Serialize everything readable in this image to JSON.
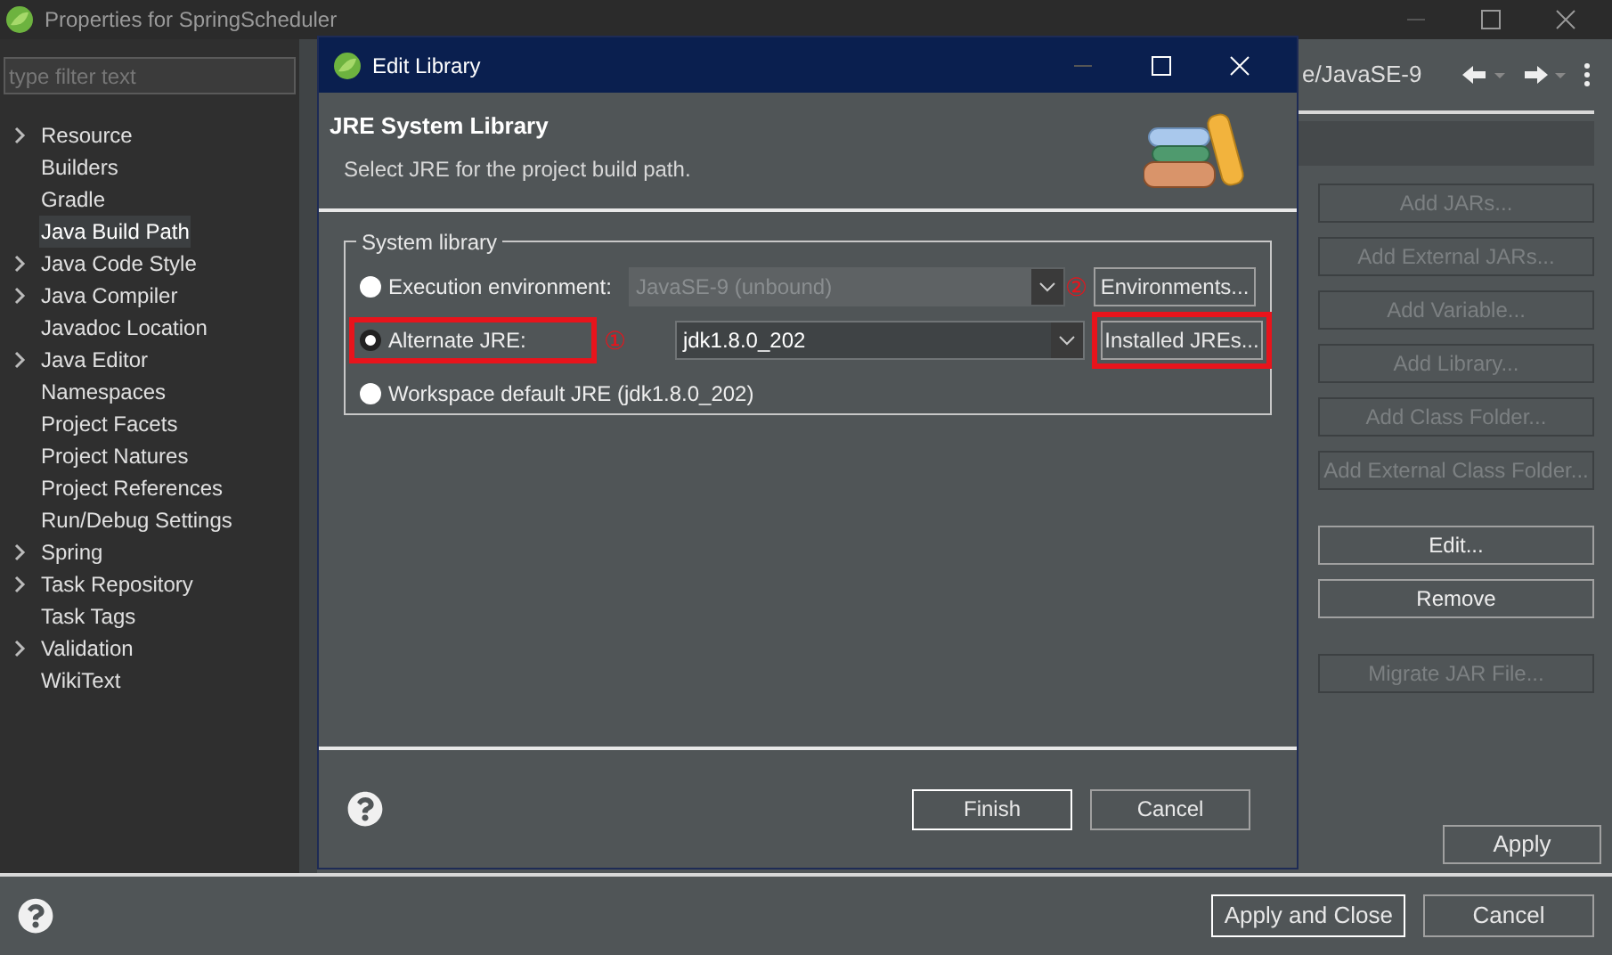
{
  "window": {
    "title": "Properties for SpringScheduler"
  },
  "filter": {
    "placeholder": "type filter text"
  },
  "sidebar": {
    "items": [
      {
        "label": "Resource",
        "has_children": true,
        "selected": false
      },
      {
        "label": "Builders",
        "has_children": false,
        "selected": false
      },
      {
        "label": "Gradle",
        "has_children": false,
        "selected": false
      },
      {
        "label": "Java Build Path",
        "has_children": false,
        "selected": true
      },
      {
        "label": "Java Code Style",
        "has_children": true,
        "selected": false
      },
      {
        "label": "Java Compiler",
        "has_children": true,
        "selected": false
      },
      {
        "label": "Javadoc Location",
        "has_children": false,
        "selected": false
      },
      {
        "label": "Java Editor",
        "has_children": true,
        "selected": false
      },
      {
        "label": "Namespaces",
        "has_children": false,
        "selected": false
      },
      {
        "label": "Project Facets",
        "has_children": false,
        "selected": false
      },
      {
        "label": "Project Natures",
        "has_children": false,
        "selected": false
      },
      {
        "label": "Project References",
        "has_children": false,
        "selected": false
      },
      {
        "label": "Run/Debug Settings",
        "has_children": false,
        "selected": false
      },
      {
        "label": "Spring",
        "has_children": true,
        "selected": false
      },
      {
        "label": "Task Repository",
        "has_children": true,
        "selected": false
      },
      {
        "label": "Task Tags",
        "has_children": false,
        "selected": false
      },
      {
        "label": "Validation",
        "has_children": true,
        "selected": false
      },
      {
        "label": "WikiText",
        "has_children": false,
        "selected": false
      }
    ]
  },
  "breadcrumb": "e/JavaSE-9",
  "side_button_groups": [
    [
      {
        "label": "Add JARs...",
        "disabled": true
      },
      {
        "label": "Add External JARs...",
        "disabled": true
      },
      {
        "label": "Add Variable...",
        "disabled": true
      },
      {
        "label": "Add Library...",
        "disabled": true
      },
      {
        "label": "Add Class Folder...",
        "disabled": true
      },
      {
        "label": "Add External Class Folder...",
        "disabled": true
      }
    ],
    [
      {
        "label": "Edit...",
        "disabled": false
      },
      {
        "label": "Remove",
        "disabled": false
      }
    ],
    [
      {
        "label": "Migrate JAR File...",
        "disabled": true
      }
    ]
  ],
  "apply_button": "Apply",
  "footer_buttons": [
    {
      "label": "Apply and Close",
      "default": true
    },
    {
      "label": "Cancel",
      "default": false
    }
  ],
  "dialog": {
    "title": "Edit Library",
    "heading": "JRE System Library",
    "description": "Select JRE for the project build path.",
    "group": "System library",
    "options": [
      {
        "label": "Execution environment:",
        "selected": false,
        "combo": "JavaSE-9 (unbound)",
        "combo_disabled": true,
        "button": "Environments...",
        "highlighted": false,
        "marker": "②"
      },
      {
        "label": "Alternate JRE:",
        "selected": true,
        "combo": "jdk1.8.0_202",
        "combo_disabled": false,
        "button": "Installed JREs...",
        "highlighted": true,
        "marker": "①"
      },
      {
        "label": "Workspace default JRE (jdk1.8.0_202)",
        "selected": false
      }
    ],
    "buttons": [
      {
        "label": "Finish",
        "default": true
      },
      {
        "label": "Cancel",
        "default": false
      }
    ]
  }
}
